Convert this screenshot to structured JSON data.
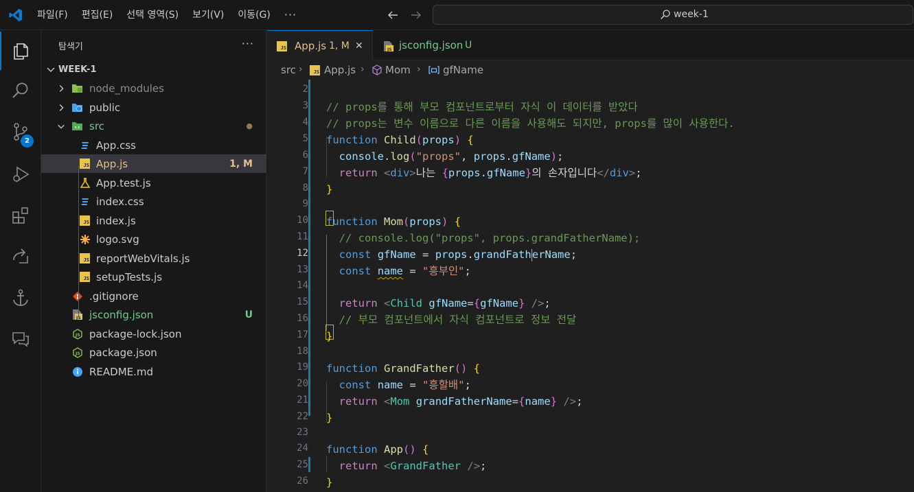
{
  "menu": [
    "파일(F)",
    "편집(E)",
    "선택 영역(S)",
    "보기(V)",
    "이동(G)",
    "···"
  ],
  "search": {
    "text": "week-1"
  },
  "activity": {
    "scm_badge": "2"
  },
  "sidebar": {
    "title": "탐색기",
    "more": "···",
    "root": "WEEK-1",
    "items": [
      {
        "name": "node_modules",
        "type": "folder",
        "icon": "folder-node-icon",
        "color": "#8b8b8b",
        "status": ""
      },
      {
        "name": "public",
        "type": "folder",
        "icon": "folder-public-icon",
        "color": "#cccccc",
        "status": ""
      },
      {
        "name": "src",
        "type": "folder-open",
        "icon": "folder-src-icon",
        "color": "#73c991",
        "status": "●"
      },
      {
        "name": "App.css",
        "type": "file",
        "icon": "css-icon",
        "color": "#cccccc",
        "status": ""
      },
      {
        "name": "App.js",
        "type": "file",
        "icon": "js-icon",
        "color": "#e2c08d",
        "status": "1, M"
      },
      {
        "name": "App.test.js",
        "type": "file",
        "icon": "test-flask-icon",
        "color": "#cccccc",
        "status": ""
      },
      {
        "name": "index.css",
        "type": "file",
        "icon": "css-icon",
        "color": "#cccccc",
        "status": ""
      },
      {
        "name": "index.js",
        "type": "file",
        "icon": "js-icon",
        "color": "#cccccc",
        "status": ""
      },
      {
        "name": "logo.svg",
        "type": "file",
        "icon": "svg-icon",
        "color": "#cccccc",
        "status": ""
      },
      {
        "name": "reportWebVitals.js",
        "type": "file",
        "icon": "js-icon",
        "color": "#cccccc",
        "status": ""
      },
      {
        "name": "setupTests.js",
        "type": "file",
        "icon": "js-icon",
        "color": "#cccccc",
        "status": ""
      },
      {
        "name": ".gitignore",
        "type": "file",
        "icon": "git-icon",
        "color": "#cccccc",
        "status": ""
      },
      {
        "name": "jsconfig.json",
        "type": "file",
        "icon": "jsconfig-icon",
        "color": "#73c991",
        "status": "U"
      },
      {
        "name": "package-lock.json",
        "type": "file",
        "icon": "nodejs-icon",
        "color": "#cccccc",
        "status": ""
      },
      {
        "name": "package.json",
        "type": "file",
        "icon": "nodejs-icon",
        "color": "#cccccc",
        "status": ""
      },
      {
        "name": "README.md",
        "type": "file",
        "icon": "info-icon",
        "color": "#cccccc",
        "status": ""
      }
    ]
  },
  "tabs": [
    {
      "label": "App.js",
      "status": "1, M",
      "close": "✕",
      "color": "#e2c08d"
    },
    {
      "label": "jsconfig.json",
      "status": "U",
      "color": "#73c991"
    }
  ],
  "breadcrumb": [
    "src",
    "App.js",
    "Mom",
    "gfName"
  ],
  "editor": {
    "line_numbers": [
      "2",
      "3",
      "4",
      "5",
      "6",
      "7",
      "8",
      "9",
      "10",
      "11",
      "12",
      "13",
      "14",
      "15",
      "16",
      "17",
      "18",
      "19",
      "20",
      "21",
      "22",
      "23",
      "24",
      "25",
      "26"
    ],
    "current_line": "12"
  },
  "colors": {
    "accent": "#0078d4",
    "modified": "#e2c08d",
    "untracked": "#73c991"
  }
}
